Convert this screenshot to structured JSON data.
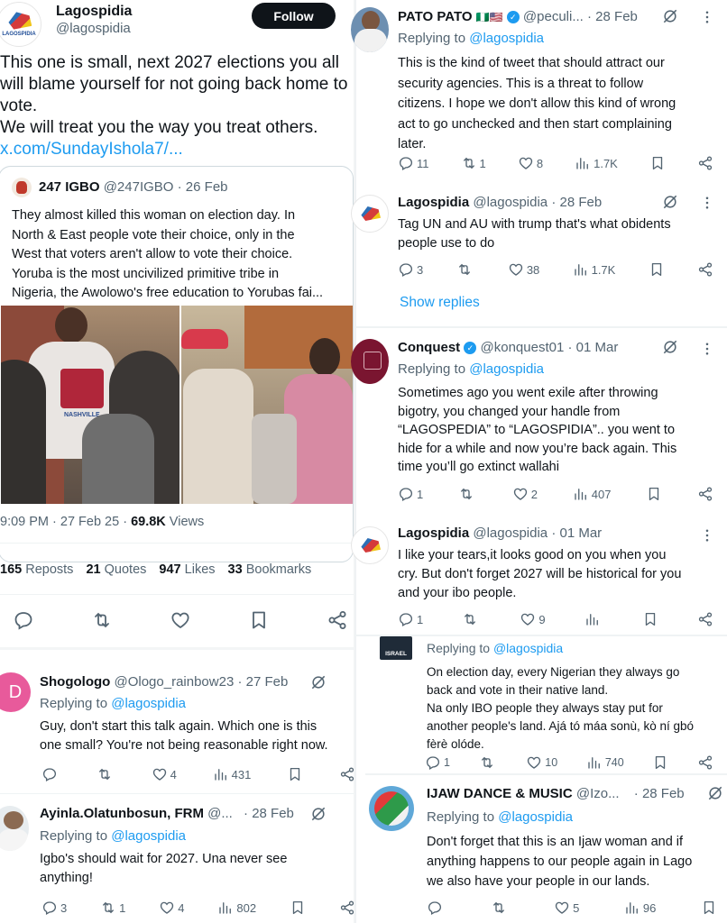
{
  "main_tweet": {
    "name": "Lagospidia",
    "handle": "@lagospidia",
    "follow_label": "Follow",
    "avatar_text": "LAGOSPIDIA",
    "text_line1": "This one is small, next 2027 elections you all",
    "text_line2": "will blame yourself for not going back home to",
    "text_line3": "vote.",
    "text_line4": "We will treat you the way you treat others.",
    "link": "x.com/SundayIshola7/...",
    "quoted": {
      "name": "247 IGBO",
      "handle": "@247IGBO",
      "date": "· 26 Feb",
      "lines": [
        "They almost killed this woman on election day. In",
        "North & East people vote their choice, only in the",
        "West that voters aren't allow to vote their choice.",
        "Yoruba is the most uncivilized primitive tribe in",
        "Nigeria, the Awolowo's free education to Yorubas fai..."
      ],
      "shirt_text": "NASHVILLE"
    },
    "time": "9:09 PM · 27 Feb 25 · ",
    "views_count": "69.8K",
    "views_label": " Views",
    "stats": {
      "reposts_count": "165",
      "reposts_label": " Reposts",
      "quotes_count": "21",
      "quotes_label": " Quotes",
      "likes_count": "947",
      "likes_label": " Likes",
      "bookmarks_count": "33",
      "bookmarks_label": " Bookmarks"
    }
  },
  "left_replies": [
    {
      "avatar_letter": "D",
      "name": "Shogologo",
      "handle": "@Ologo_rainbow23",
      "date": "· 27 Feb",
      "replying_prefix": "Replying to ",
      "replying_handle": "@lagospidia",
      "lines": [
        "Guy, don't start this talk again. Which one is this",
        "one small? You're not being reasonable right now."
      ],
      "replies": "",
      "reposts": "",
      "likes": "4",
      "views": "431"
    },
    {
      "name": "Ayinla.Olatunbosun, FRM",
      "handle": "@...",
      "date": "· 28 Feb",
      "replying_prefix": "Replying to ",
      "replying_handle": "@lagospidia",
      "lines": [
        "Igbo's should wait for 2027. Una never see",
        "anything!"
      ],
      "replies": "3",
      "reposts": "1",
      "likes": "4",
      "views": "802"
    }
  ],
  "right_replies": [
    {
      "name": "PATO PATO",
      "flags": "🇳🇬🇺🇸",
      "handle": "@peculi...",
      "date": "· 28 Feb",
      "replying_prefix": "Replying to ",
      "replying_handle": "@lagospidia",
      "lines": [
        "This is the kind of tweet that should attract our",
        "security agencies. This is a threat to follow",
        "citizens. I hope we don't allow this kind of wrong",
        "act to go unchecked and then start complaining",
        "later."
      ],
      "replies": "11",
      "reposts": "1",
      "likes": "8",
      "views": "1.7K"
    },
    {
      "name": "Lagospidia",
      "handle": "@lagospidia",
      "date": "· 28 Feb",
      "lines": [
        "Tag UN and AU with trump that's what obidents",
        "people use to do"
      ],
      "replies": "3",
      "reposts": "",
      "likes": "38",
      "views": "1.7K",
      "show_replies": "Show replies"
    },
    {
      "name": "Conquest",
      "handle": "@konquest01",
      "date": "· 01 Mar",
      "replying_prefix": "Replying to ",
      "replying_handle": "@lagospidia",
      "lines": [
        "Sometimes ago you went exile after throwing",
        "bigotry, you changed your handle from",
        "“LAGOSPEDIA” to “LAGOSPIDIA”.. you went to",
        "hide for a while and now you’re back again. This",
        "time you’ll go extinct wallahi"
      ],
      "replies": "1",
      "reposts": "",
      "likes": "2",
      "views": "407"
    },
    {
      "name": "Lagospidia",
      "handle": "@lagospidia",
      "date": "· 01 Mar",
      "lines": [
        "I like your tears,it looks good on you when you",
        "cry. But don't forget 2027 will be historical for you",
        "and your ibo people."
      ],
      "replies": "1",
      "reposts": "",
      "likes": "9",
      "views": ""
    },
    {
      "avatar_text": "ISRAEL",
      "replying_prefix": "Replying to ",
      "replying_handle": "@lagospidia",
      "lines": [
        "On election day, every Nigerian they always go",
        "back and vote in their native land.",
        "Na only IBO people they always stay put for",
        "another people's land. Ajá tó máa sonù, kò ní gbó",
        "fèrè olóde."
      ],
      "replies": "1",
      "reposts": "",
      "likes": "10",
      "views": "740"
    },
    {
      "name": "IJAW DANCE & MUSIC",
      "handle": "@Izo...",
      "date": "· 28 Feb",
      "replying_prefix": "Replying to ",
      "replying_handle": "@lagospidia",
      "lines": [
        "Don't forget that this is an Ijaw woman and if",
        "anything happens to our people again in Lago",
        "we also have your people in our lands."
      ],
      "replies": "",
      "reposts": "",
      "likes": "5",
      "views": "96"
    }
  ],
  "colors": {
    "accent_blue": "#1d9bf0",
    "text_primary": "#0f1419",
    "text_secondary": "#536471",
    "follow_button": "#0f1419"
  }
}
